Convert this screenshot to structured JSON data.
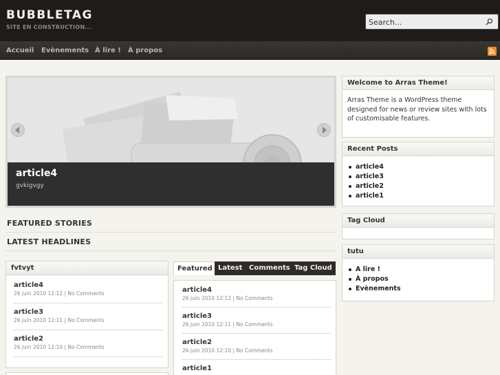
{
  "site": {
    "title": "BUBBLETAG",
    "tagline": "SITE EN CONSTRUCTION..."
  },
  "search": {
    "placeholder": "Search..."
  },
  "nav": [
    "Accueil",
    "Evènements",
    "À lire !",
    "À propos"
  ],
  "slider": {
    "title": "article4",
    "excerpt": "gvkigvgy"
  },
  "sections": {
    "featured": "FEATURED STORIES",
    "latest": "LATEST HEADLINES"
  },
  "left_widget": {
    "title": "fvtvyt",
    "posts": [
      {
        "title": "article4",
        "date": "26 juin 2010 12:12",
        "comments": "No Comments"
      },
      {
        "title": "article3",
        "date": "26 juin 2010 12:11",
        "comments": "No Comments"
      },
      {
        "title": "article2",
        "date": "26 juin 2010 12:10",
        "comments": "No Comments"
      }
    ]
  },
  "tabs": [
    "Featured",
    "Latest",
    "Comments",
    "Tag Cloud"
  ],
  "tab_posts": [
    {
      "title": "article4",
      "date": "26 juin 2010 12:12",
      "comments": "No Comments"
    },
    {
      "title": "article3",
      "date": "26 juin 2010 12:11",
      "comments": "No Comments"
    },
    {
      "title": "article2",
      "date": "26 juin 2010 12:10",
      "comments": "No Comments"
    },
    {
      "title": "article1"
    }
  ],
  "meta_sep": " | ",
  "sidebar": {
    "welcome": {
      "title": "Welcome to Arras Theme!",
      "text": "Arras Theme is a WordPress theme designed for news or review sites with lots of customisable features."
    },
    "recent": {
      "title": "Recent Posts",
      "items": [
        "article4",
        "article3",
        "article2",
        "article1"
      ]
    },
    "tagcloud": {
      "title": "Tag Cloud"
    },
    "tutu": {
      "title": "tutu",
      "items": [
        "A lire !",
        "À propos",
        "Evènements"
      ]
    }
  },
  "colors": {
    "header_bg": "#1e1b19",
    "page_bg": "#f4f3ee",
    "tab_dark": "#2e2b29",
    "rss": "#f08a20"
  }
}
